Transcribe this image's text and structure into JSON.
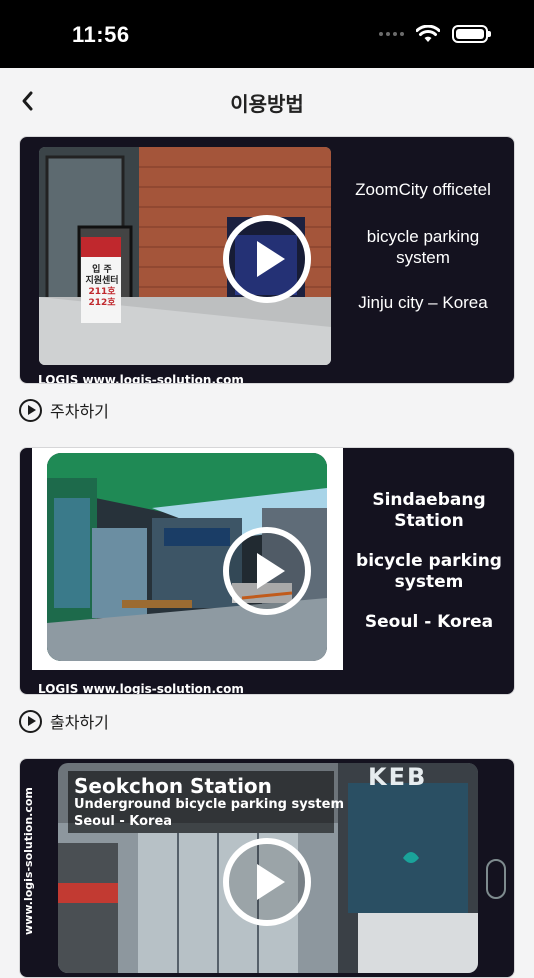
{
  "status": {
    "time": "11:56"
  },
  "nav": {
    "title": "이용방법"
  },
  "cards": [
    {
      "lines": [
        "ZoomCity officetel",
        "bicycle parking system",
        "Jinju city – Korea"
      ],
      "sign_text": [
        "입  주",
        "지원센터",
        "211호",
        "212호"
      ],
      "watermark": "LOGIS  www.logis-solution.com"
    },
    {
      "lines": [
        "Sindaebang Station",
        "bicycle parking system",
        "Seoul - Korea"
      ],
      "watermark": "LOGIS  www.logis-solution.com"
    },
    {
      "overlay_title": "Seokchon Station",
      "overlay_sub1": "Underground bicycle parking system",
      "overlay_sub2": "Seoul - Korea",
      "side_url": "www.logis-solution.com",
      "kebsign": "KEB"
    }
  ],
  "actions": [
    {
      "label": "주차하기"
    },
    {
      "label": "출차하기"
    }
  ]
}
